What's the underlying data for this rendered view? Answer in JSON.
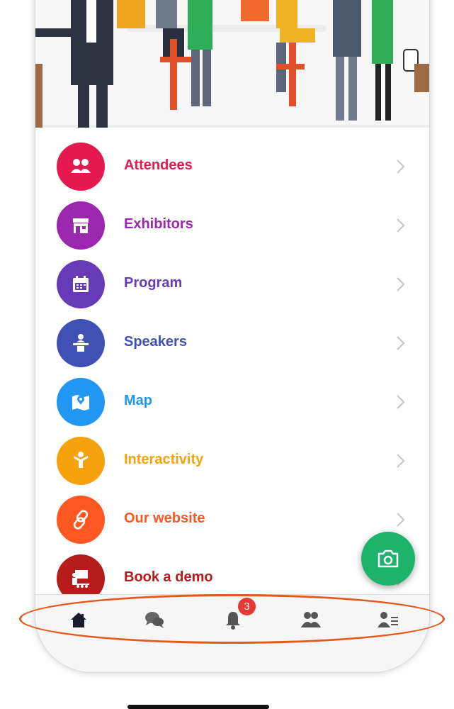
{
  "menu": {
    "items": [
      {
        "label": "Attendees",
        "color": "#e5194f",
        "icon": "attendees-icon"
      },
      {
        "label": "Exhibitors",
        "color": "#9b27af",
        "icon": "exhibitors-booth-icon"
      },
      {
        "label": "Program",
        "color": "#673ab7",
        "icon": "calendar-icon"
      },
      {
        "label": "Speakers",
        "color": "#3f51b5",
        "icon": "speaker-podium-icon"
      },
      {
        "label": "Map",
        "color": "#2196f3",
        "icon": "map-pin-icon"
      },
      {
        "label": "Interactivity",
        "color": "#f5a20c",
        "icon": "raised-hand-person-icon"
      },
      {
        "label": "Our website",
        "color": "#ff5722",
        "icon": "link-icon"
      },
      {
        "label": "Book a demo",
        "color": "#b71c1c",
        "icon": "presentation-icon"
      }
    ]
  },
  "tabbar": {
    "notification_count": "3",
    "tabs": [
      "home-icon",
      "chat-icon",
      "bell-icon",
      "people-icon",
      "profile-list-icon"
    ]
  },
  "fab": {
    "icon": "camera-icon",
    "color": "#1db36b"
  },
  "highlight": {
    "color": "#e8581a"
  }
}
